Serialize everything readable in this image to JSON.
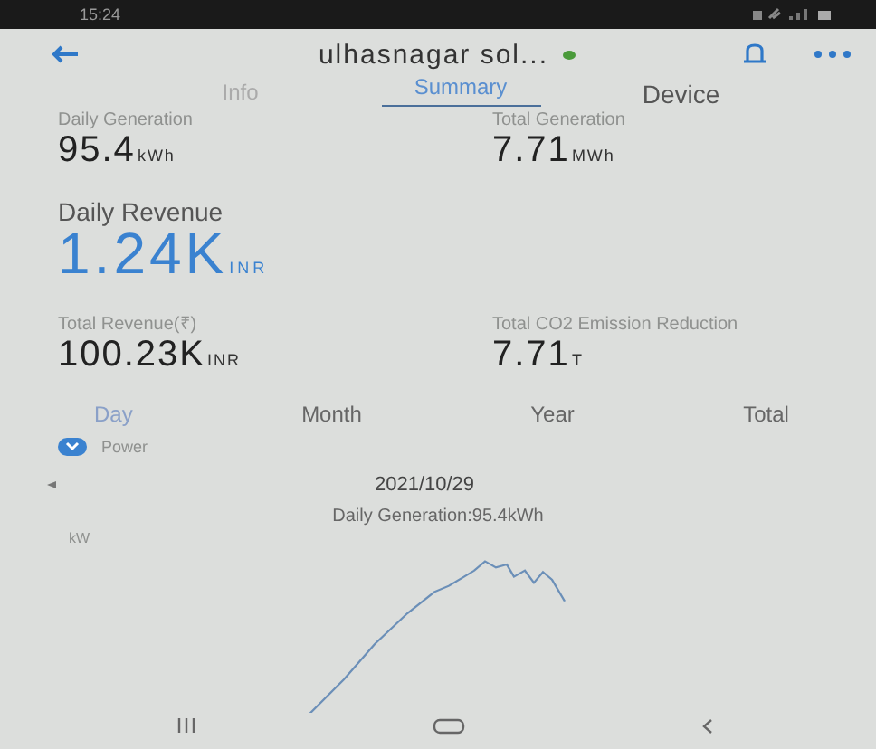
{
  "status_bar": {
    "time": "15:24"
  },
  "header": {
    "title": "ulhasnagar sol...",
    "online": true
  },
  "tabs": [
    {
      "label": "Info",
      "selected": false
    },
    {
      "label": "Summary",
      "selected": true
    },
    {
      "label": "Device",
      "selected": false
    }
  ],
  "stats_top": [
    {
      "label": "Daily Generation",
      "value": "95.4",
      "unit": "kWh"
    },
    {
      "label": "Total Generation",
      "value": "7.71",
      "unit": "MWh"
    }
  ],
  "daily_revenue": {
    "label": "Daily Revenue",
    "value": "1.24K",
    "unit": "INR"
  },
  "stats_bottom": [
    {
      "label": "Total Revenue(₹)",
      "value": "100.23K",
      "unit": "INR"
    },
    {
      "label": "Total CO2 Emission Reduction",
      "value": "7.71",
      "unit": "T"
    }
  ],
  "periods": [
    {
      "label": "Day",
      "selected": true
    },
    {
      "label": "Month",
      "selected": false
    },
    {
      "label": "Year",
      "selected": false
    },
    {
      "label": "Total",
      "selected": false
    }
  ],
  "legend": {
    "label": "Power",
    "checked": true
  },
  "date": "2021/10/29",
  "chart_title": "Daily Generation:95.4kWh",
  "y_unit": "kW"
}
